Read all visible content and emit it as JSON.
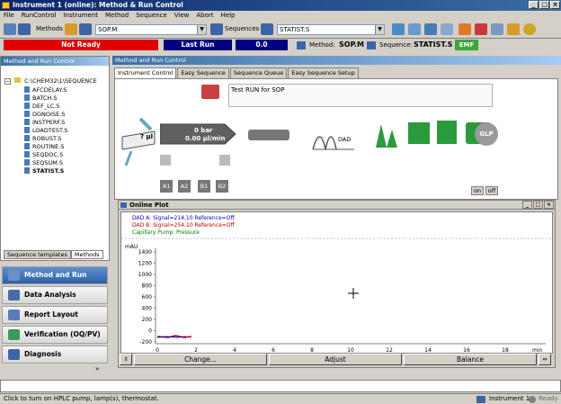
{
  "title": "Instrument 1 (online): Method & Run Control",
  "menu": [
    "File",
    "RunControl",
    "Instrument",
    "Method",
    "Sequence",
    "View",
    "Abort",
    "Help"
  ],
  "toolbar": {
    "methods_label": "Methods",
    "method_value": "SOP.M",
    "sequences_label": "Sequences",
    "sequence_value": "STATIST.S"
  },
  "status": {
    "ready": "Not Ready",
    "last_run": "Last Run",
    "counter": "0.0",
    "method_label": "Method:",
    "method": "SOP.M",
    "sequence_label": "Sequence:",
    "sequence": "STATIST.S",
    "emf": "EMF"
  },
  "left": {
    "header": "Method and Run Control",
    "root": "C:\\CHEM32\\1\\SEQUENCE",
    "items": [
      "AFCDELAY.S",
      "BATCH.S",
      "DEF_LC.S",
      "DGNOISE.S",
      "INSTPERF.S",
      "LOADTEST.S",
      "ROBUST.S",
      "ROUTINE.S",
      "SEQDOC.S",
      "SEQSUM.S",
      "STATIST.S"
    ],
    "tabs": [
      "Sequence templates",
      "Methods"
    ]
  },
  "nav": [
    {
      "label": "Method and Run Control",
      "active": true
    },
    {
      "label": "Data Analysis",
      "active": false
    },
    {
      "label": "Report Layout",
      "active": false
    },
    {
      "label": "Verification (OQ/PV)",
      "active": false
    },
    {
      "label": "Diagnosis",
      "active": false
    }
  ],
  "right": {
    "header": "Method and Run Control",
    "tabs": [
      "Instrument Control",
      "Easy Sequence",
      "Sequence Queue",
      "Easy Sequence Setup"
    ],
    "note": "Test RUN for SOP",
    "pump": {
      "sampler": "? µl",
      "pressure": "0 bar",
      "flow": "0.00 µl/min",
      "bottles": [
        "A1",
        "A2",
        "B1",
        "B2"
      ]
    },
    "dad": "DAD",
    "glp": "GLP",
    "on": "on",
    "off": "off"
  },
  "plot": {
    "title": "Online Plot",
    "legend": [
      {
        "text": "DAD A: Signal=214,10  Reference=Off",
        "color": "#0000c0"
      },
      {
        "text": "DAD B: Signal=254,10  Reference=Off",
        "color": "#c00000"
      },
      {
        "text": "Capillary Pump: Pressure",
        "color": "#008000"
      }
    ],
    "yunit": "mAU",
    "yticks": [
      "1400",
      "1200",
      "1000",
      "800",
      "600",
      "400",
      "200",
      "0",
      "-200"
    ],
    "xticks": [
      "0",
      "2",
      "4",
      "6",
      "8",
      "10",
      "12",
      "14",
      "16",
      "18"
    ],
    "xunit": "min",
    "buttons": [
      "Change...",
      "Adjust",
      "Balance"
    ]
  },
  "statusbar": {
    "text": "Click to turn on HPLC pump, lamp(s), thermostat.",
    "instrument": "Instrument 1",
    "ready": "Ready"
  }
}
